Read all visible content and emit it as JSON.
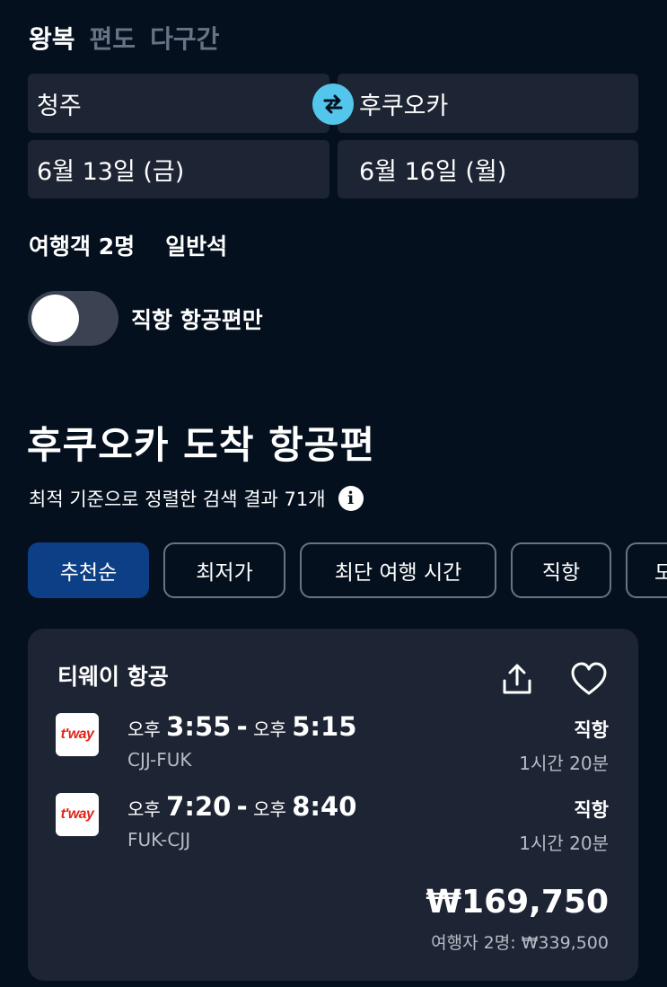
{
  "trip_type": {
    "tabs": [
      "왕복",
      "편도",
      "다구간"
    ],
    "selected": "왕복"
  },
  "search": {
    "origin": "청주",
    "destination": "후쿠오카",
    "depart_date": "6월 13일 (금)",
    "return_date": "6월 16일 (월)",
    "swap_icon": "swap-arrows-icon"
  },
  "passengers": {
    "travelers": "여행객 2명",
    "cabin": "일반석"
  },
  "direct_only": {
    "label": "직항 항공편만",
    "enabled": false
  },
  "results": {
    "title": "후쿠오카 도착 항공편",
    "summary": "최적 기준으로 정렬한 검색 결과 71개",
    "info_icon_glyph": "i"
  },
  "sort_chips": [
    "추천순",
    "최저가",
    "최단 여행 시간",
    "직항",
    "도"
  ],
  "sort_selected": "추천순",
  "flight_card": {
    "airline": "티웨이 항공",
    "logo_text": "t'way",
    "logo_color": "#e2231a",
    "legs": [
      {
        "dep_period": "오후",
        "dep_time": "3:55",
        "separator": "-",
        "arr_period": "오후",
        "arr_time": "5:15",
        "route": "CJJ-FUK",
        "stops": "직항",
        "duration": "1시간 20분"
      },
      {
        "dep_period": "오후",
        "dep_time": "7:20",
        "separator": "-",
        "arr_period": "오후",
        "arr_time": "8:40",
        "route": "FUK-CJJ",
        "stops": "직항",
        "duration": "1시간 20분"
      }
    ],
    "price": "₩169,750",
    "total_price": "여행자 2명: ₩339,500"
  },
  "colors": {
    "background": "#05101f",
    "surface": "#1d2433",
    "accent_blue": "#0c3f85",
    "swap_button": "#54c6eb",
    "muted_text": "#b7bcc6",
    "inactive_tab": "#6a7385"
  }
}
